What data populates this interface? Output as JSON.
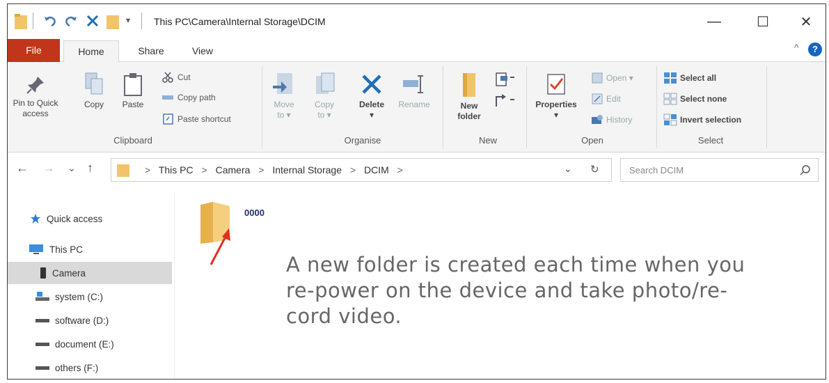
{
  "window": {
    "title": "This PC\\Camera\\Internal Storage\\DCIM",
    "minimize_glyph": "—",
    "maximize_glyph": "☐",
    "close_glyph": "✕",
    "qa_dropdown_glyph": "▾"
  },
  "tabs": [
    {
      "label": "File"
    },
    {
      "label": "Home"
    },
    {
      "label": "Share"
    },
    {
      "label": "View"
    }
  ],
  "ribbon_controls": {
    "collapse_glyph": "^",
    "help_glyph": "?"
  },
  "ribbon": {
    "clipboard": {
      "label": "Clipboard",
      "pin_label_1": "Pin to Quick",
      "pin_label_2": "access",
      "copy_label": "Copy",
      "paste_label": "Paste",
      "cut_label": "Cut",
      "copy_path_label": "Copy path",
      "paste_shortcut_label": "Paste shortcut"
    },
    "organise": {
      "label": "Organise",
      "move_to_1": "Move",
      "move_to_2": "to ▾",
      "copy_to_1": "Copy",
      "copy_to_2": "to ▾",
      "delete_1": "Delete",
      "delete_2": "▾",
      "rename": "Rename"
    },
    "new": {
      "label": "New",
      "new_folder_1": "New",
      "new_folder_2": "folder"
    },
    "open": {
      "label": "Open",
      "properties_1": "Properties",
      "properties_2": "▾",
      "open_label": "Open ▾",
      "edit_label": "Edit",
      "history_label": "History"
    },
    "select": {
      "label": "Select",
      "select_all": "Select all",
      "select_none": "Select none",
      "invert_selection": "Invert selection"
    }
  },
  "nav": {
    "back_glyph": "←",
    "forward_glyph": "→",
    "recent_glyph": "⌄",
    "up_glyph": "↑",
    "breadcrumb": [
      "This PC",
      "Camera",
      "Internal Storage",
      "DCIM"
    ],
    "separator": ">",
    "dropdown_glyph": "⌄",
    "refresh_glyph": "↻",
    "search_placeholder": "Search DCIM"
  },
  "sidebar": {
    "items": [
      {
        "label": "Quick access",
        "icon": "star-icon"
      },
      {
        "label": "This PC",
        "icon": "monitor-icon"
      },
      {
        "label": "Camera",
        "icon": "phone-icon",
        "selected": true
      },
      {
        "label": "system (C:)",
        "icon": "drive-icon"
      },
      {
        "label": "software (D:)",
        "icon": "drive-icon"
      },
      {
        "label": "document (E:)",
        "icon": "drive-icon"
      },
      {
        "label": "others (F:)",
        "icon": "drive-icon"
      }
    ]
  },
  "content": {
    "folders": [
      {
        "name": "0000"
      }
    ]
  },
  "caption": {
    "line1": "A new folder is created each time when you",
    "line2": "re-power on the device and take photo/re-",
    "line3": "cord video."
  },
  "colors": {
    "file_tab": "#c1351a",
    "folder": "#f2c46a",
    "arrow": "#e03020",
    "delete_x": "#1f6fb7",
    "help": "#1565c0"
  }
}
